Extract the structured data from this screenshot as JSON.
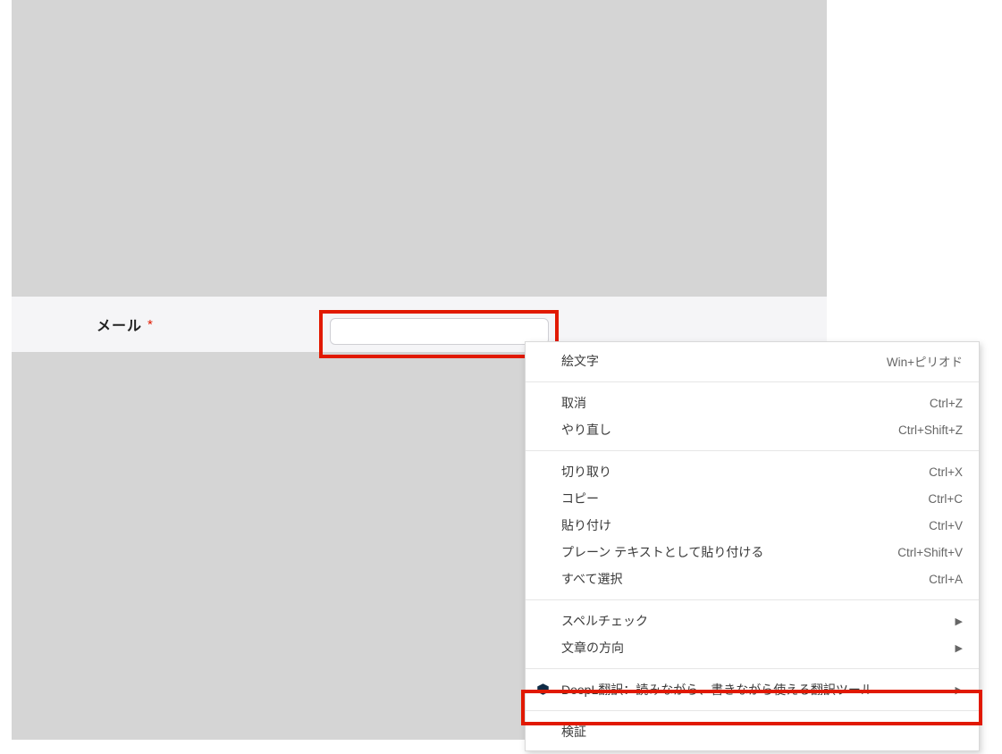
{
  "field": {
    "label": "メール",
    "required_mark": "*"
  },
  "context_menu": {
    "group1": [
      {
        "label": "絵文字",
        "shortcut": "Win+ピリオド"
      }
    ],
    "group2": [
      {
        "label": "取消",
        "shortcut": "Ctrl+Z"
      },
      {
        "label": "やり直し",
        "shortcut": "Ctrl+Shift+Z"
      }
    ],
    "group3": [
      {
        "label": "切り取り",
        "shortcut": "Ctrl+X"
      },
      {
        "label": "コピー",
        "shortcut": "Ctrl+C"
      },
      {
        "label": "貼り付け",
        "shortcut": "Ctrl+V"
      },
      {
        "label": "プレーン テキストとして貼り付ける",
        "shortcut": "Ctrl+Shift+V"
      },
      {
        "label": "すべて選択",
        "shortcut": "Ctrl+A"
      }
    ],
    "group4": [
      {
        "label": "スペルチェック",
        "submenu": true
      },
      {
        "label": "文章の方向",
        "submenu": true
      }
    ],
    "group5_icon_label": "DeepL翻訳：読みながら、書きながら使える翻訳ツール",
    "group6_label": "検証"
  }
}
